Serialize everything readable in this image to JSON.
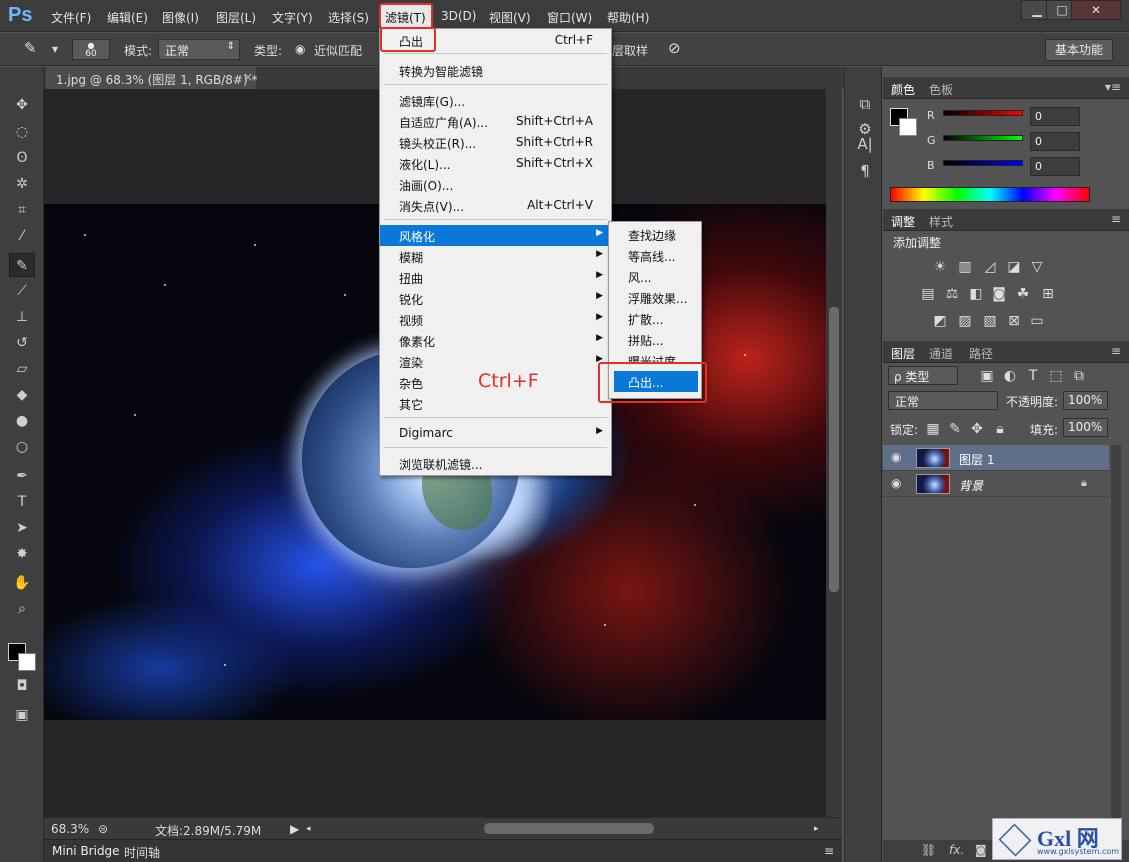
{
  "app": {
    "logo": "Ps"
  },
  "menubar": {
    "items": [
      "文件(F)",
      "编辑(E)",
      "图像(I)",
      "图层(L)",
      "文字(Y)",
      "选择(S)",
      "滤镜(T)",
      "3D(D)",
      "视图(V)",
      "窗口(W)",
      "帮助(H)"
    ],
    "active": "滤镜(T)"
  },
  "window_controls": {
    "minimize": "▁",
    "maximize": "□",
    "close": "✕"
  },
  "options": {
    "brush_size": "60",
    "mode_label": "模式:",
    "mode_value": "正常",
    "type_label": "类型:",
    "type_value": "近似匹配",
    "sample_label": "层取样",
    "workspace": "基本功能"
  },
  "document": {
    "tab_title": "1.jpg @ 68.3% (图层 1, RGB/8#) *",
    "close": "×"
  },
  "status": {
    "zoom": "68.3%",
    "doc_info": "文档:2.89M/5.79M"
  },
  "bottom_tabs": [
    "Mini Bridge",
    "时间轴"
  ],
  "filter_menu": {
    "last_filter": {
      "label": "凸出",
      "shortcut": "Ctrl+F"
    },
    "smart": "转换为智能滤镜",
    "group1": [
      {
        "label": "滤镜库(G)...",
        "shortcut": ""
      },
      {
        "label": "自适应广角(A)...",
        "shortcut": "Shift+Ctrl+A"
      },
      {
        "label": "镜头校正(R)...",
        "shortcut": "Shift+Ctrl+R"
      },
      {
        "label": "液化(L)...",
        "shortcut": "Shift+Ctrl+X"
      },
      {
        "label": "油画(O)...",
        "shortcut": ""
      },
      {
        "label": "消失点(V)...",
        "shortcut": "Alt+Ctrl+V"
      }
    ],
    "group2": [
      "风格化",
      "模糊",
      "扭曲",
      "锐化",
      "视频",
      "像素化",
      "渲染",
      "杂色",
      "其它"
    ],
    "digimarc": "Digimarc",
    "browse": "浏览联机滤镜..."
  },
  "stylize_submenu": [
    "查找边缘",
    "等高线...",
    "风...",
    "浮雕效果...",
    "扩散...",
    "拼贴...",
    "曝光过度",
    "凸出..."
  ],
  "annotation": "Ctrl+F",
  "color_panel": {
    "tabs": [
      "颜色",
      "色板"
    ],
    "channels": [
      {
        "label": "R",
        "value": "0",
        "color": "#ff0000"
      },
      {
        "label": "G",
        "value": "0",
        "color": "#00ff00"
      },
      {
        "label": "B",
        "value": "0",
        "color": "#0000ff"
      }
    ]
  },
  "adjust_panel": {
    "tabs": [
      "调整",
      "样式"
    ],
    "title": "添加调整"
  },
  "layers_panel": {
    "tabs": [
      "图层",
      "通道",
      "路径"
    ],
    "filter_label": "ρ 类型",
    "blend_mode": "正常",
    "opacity_label": "不透明度:",
    "opacity": "100%",
    "lock_label": "锁定:",
    "fill_label": "填充:",
    "fill": "100%",
    "layers": [
      {
        "name": "图层 1",
        "selected": true
      },
      {
        "name": "背景",
        "selected": false
      }
    ],
    "footer_fx": "fx."
  },
  "watermark": {
    "brand": "Gxl 网",
    "url": "www.gxlsystem.com"
  }
}
